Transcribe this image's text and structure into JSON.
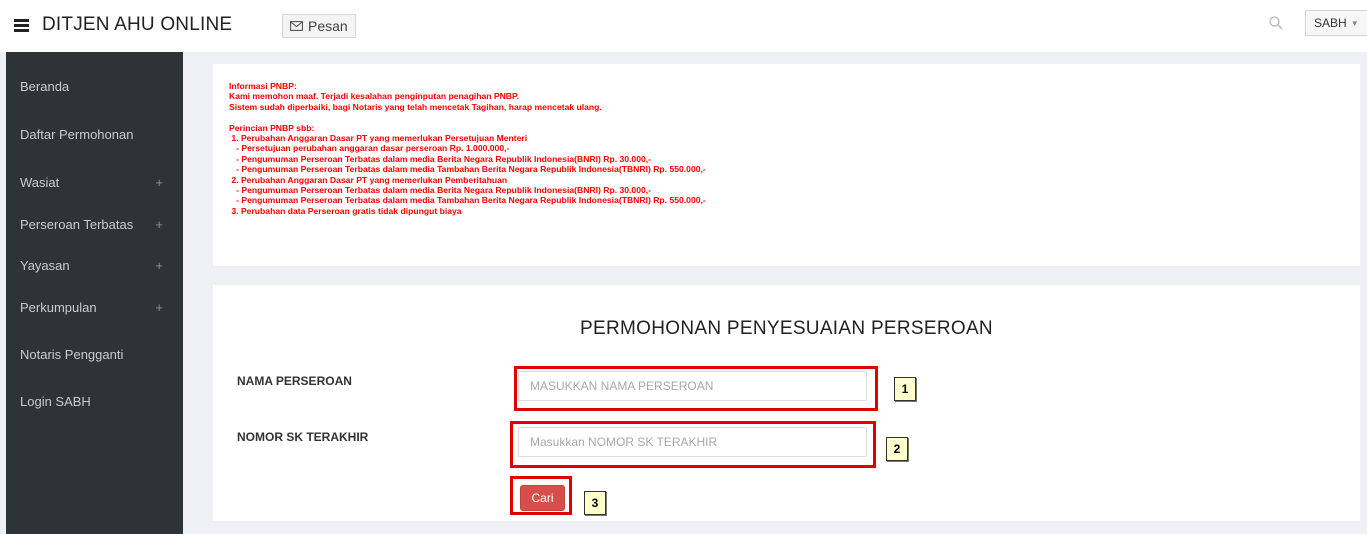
{
  "header": {
    "brand": "DITJEN AHU ONLINE",
    "message_button": "Pesan",
    "user_menu": "SABH",
    "icons": [
      "menu-icon",
      "envelope-icon",
      "search-icon",
      "caret-down-icon"
    ]
  },
  "sidebar": {
    "items": [
      {
        "label": "Beranda",
        "expandable": ""
      },
      {
        "label": "Daftar Permohonan",
        "expandable": ""
      },
      {
        "label": "Wasiat",
        "expandable": "+"
      },
      {
        "label": "Perseroan Terbatas",
        "expandable": "+"
      },
      {
        "label": "Yayasan",
        "expandable": "+"
      },
      {
        "label": "Perkumpulan",
        "expandable": "+"
      },
      {
        "label": "Notaris Pengganti",
        "expandable": ""
      },
      {
        "label": "Login SABH",
        "expandable": ""
      }
    ]
  },
  "info": {
    "lines": [
      "Informasi PNBP:",
      "Kami memohon maaf. Terjadi kesalahan penginputan penagihan PNBP.",
      "Sistem sudah diperbaiki, bagi Notaris yang telah mencetak Tagihan, harap mencetak ulang.",
      "",
      "Perincian PNBP sbb:",
      " 1. Perubahan Anggaran Dasar PT yang memerlukan Persetujuan Menteri",
      "   - Persetujuan perubahan anggaran dasar perseroan Rp. 1.000.000,-",
      "   - Pengumuman Perseroan Terbatas dalam media Berita Negara Republik Indonesia(BNRI) Rp. 30.000,-",
      "   - Pengumuman Perseroan Terbatas dalam media Tambahan Berita Negara Republik Indonesia(TBNRI) Rp. 550.000,-",
      " 2. Perubahan Anggaran Dasar PT yang memerlukan Pemberitahuan",
      "   - Pengumuman Perseroan Terbatas dalam media Berita Negara Republik Indonesia(BNRI) Rp. 30.000,-",
      "   - Pengumuman Perseroan Terbatas dalam media Tambahan Berita Negara Republik Indonesia(TBNRI) Rp. 550.000,-",
      " 3. Perubahan data Perseroan gratis tidak dipungut biaya"
    ],
    "color": "#ff0000"
  },
  "form": {
    "title": "PERMOHONAN PENYESUAIAN PERSEROAN",
    "nama_label": "NAMA PERSEROAN",
    "nama_placeholder": "MASUKKAN NAMA PERSEROAN",
    "nama_value": "",
    "sk_label": "NOMOR SK TERAKHIR",
    "sk_placeholder": "Masukkan NOMOR SK TERAKHIR",
    "sk_value": "",
    "submit_label": "Cari"
  },
  "annotations": [
    "1",
    "2",
    "3"
  ],
  "colors": {
    "sidebar_bg": "#2e3338",
    "content_bg": "#eef0f3",
    "button_red": "#d64f4c",
    "annotation_red": "#e00000",
    "annotation_label_bg": "#ffffcc"
  }
}
